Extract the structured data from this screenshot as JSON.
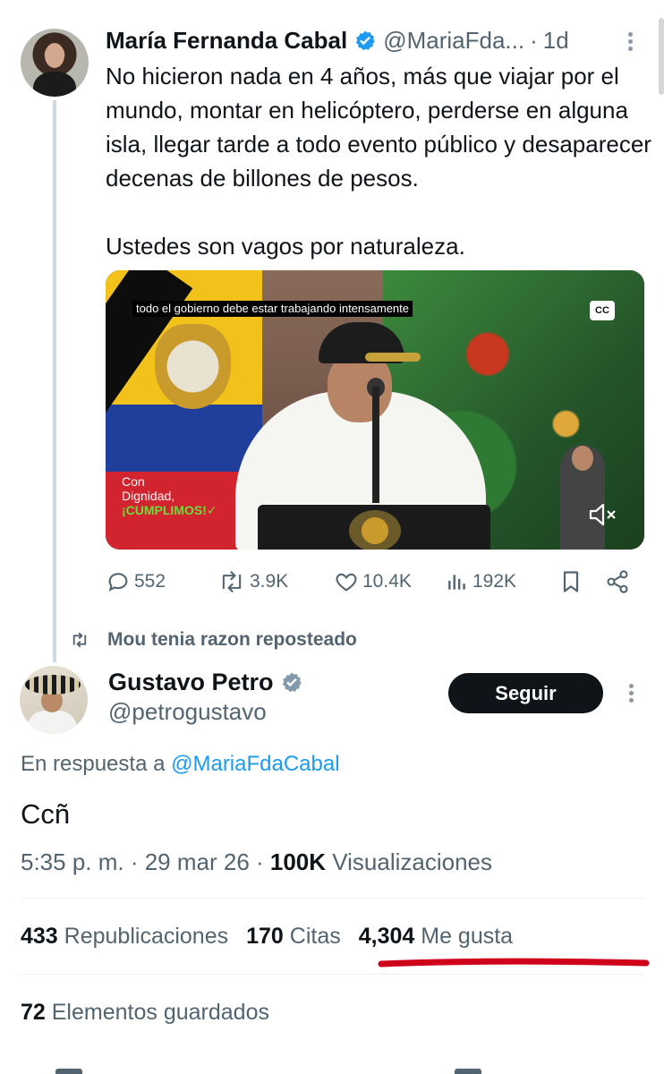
{
  "quoted_tweet": {
    "name": "María Fernanda Cabal",
    "handle": "@MariaFda...",
    "dot": "·",
    "time": "1d",
    "text": "No hicieron nada en 4 años, más que viajar por el mundo, montar en helicóptero, perderse en alguna isla, llegar tarde a todo evento público y desaparecer decenas de billones de pesos.\n\nUstedes son vagos por naturaleza.",
    "video": {
      "caption": "todo el gobierno debe estar trabajando intensamente",
      "cc_label": "CC",
      "logo_line1": "Con",
      "logo_line2": "Dignidad,",
      "logo_line3": "¡CUMPLIMOS!✓",
      "mute_icon": "speaker-muted-icon"
    },
    "actions": {
      "replies": "552",
      "reposts": "3.9K",
      "likes": "10.4K",
      "views": "192K"
    }
  },
  "repost_banner": "Mou tenia razon reposteado",
  "tweet": {
    "name": "Gustavo Petro",
    "handle": "@petrogustavo",
    "follow_label": "Seguir",
    "reply_prefix": "En respuesta a ",
    "reply_handle": "@MariaFdaCabal",
    "text": "Ccñ",
    "time": "5:35 p. m. · 29 mar 26 · ",
    "views_count": "100K",
    "views_label": " Visualizaciones",
    "reposts_count": "433",
    "reposts_label": " Republicaciones",
    "quotes_count": "170",
    "quotes_label": " Citas",
    "likes_count": "4,304",
    "likes_label": " Me gusta",
    "bookmarks_count": "72",
    "bookmarks_label": " Elementos guardados"
  },
  "colors": {
    "verified": "#1d9bf0",
    "secondary_text": "#536471",
    "annotation_underline": "#d0021b",
    "follow_button_bg": "#0f1419"
  }
}
